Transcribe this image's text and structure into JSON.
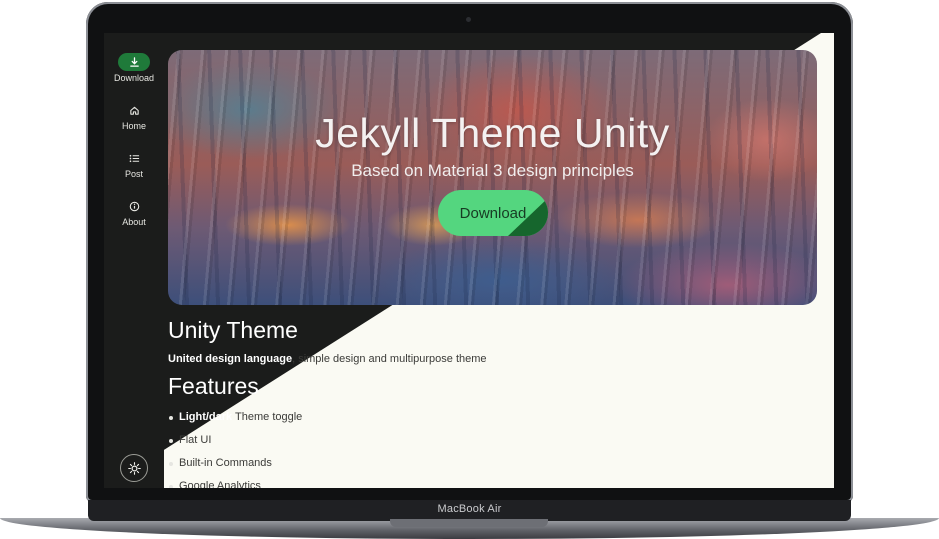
{
  "device": {
    "model_label": "MacBook Air"
  },
  "rail": {
    "items": [
      {
        "label": "Download",
        "icon": "download-icon",
        "active": true
      },
      {
        "label": "Home",
        "icon": "home-icon",
        "active": false
      },
      {
        "label": "Post",
        "icon": "list-icon",
        "active": false
      },
      {
        "label": "About",
        "icon": "info-icon",
        "active": false
      }
    ],
    "theme_toggle_icon": "sun-icon"
  },
  "hero": {
    "title": "Jekyll Theme Unity",
    "subtitle": "Based on Material 3 design principles",
    "button_label": "Download"
  },
  "content": {
    "title": "Unity Theme",
    "tagline_bold": "United design language",
    "tagline_rest": ", simple design and multipurpose theme",
    "features_title": "Features",
    "features": [
      {
        "bold": "Light/dark",
        "text": " Theme toggle"
      },
      {
        "bold": "",
        "text": "Flat UI"
      },
      {
        "bold": "",
        "text": "Built-in Commands"
      },
      {
        "bold": "",
        "text": "Google Analytics"
      }
    ]
  },
  "colors": {
    "dark_surface": "#1b1c1b",
    "light_surface": "#fafaf3",
    "accent_green": "#54d67f",
    "accent_green_dark": "#16662d"
  }
}
